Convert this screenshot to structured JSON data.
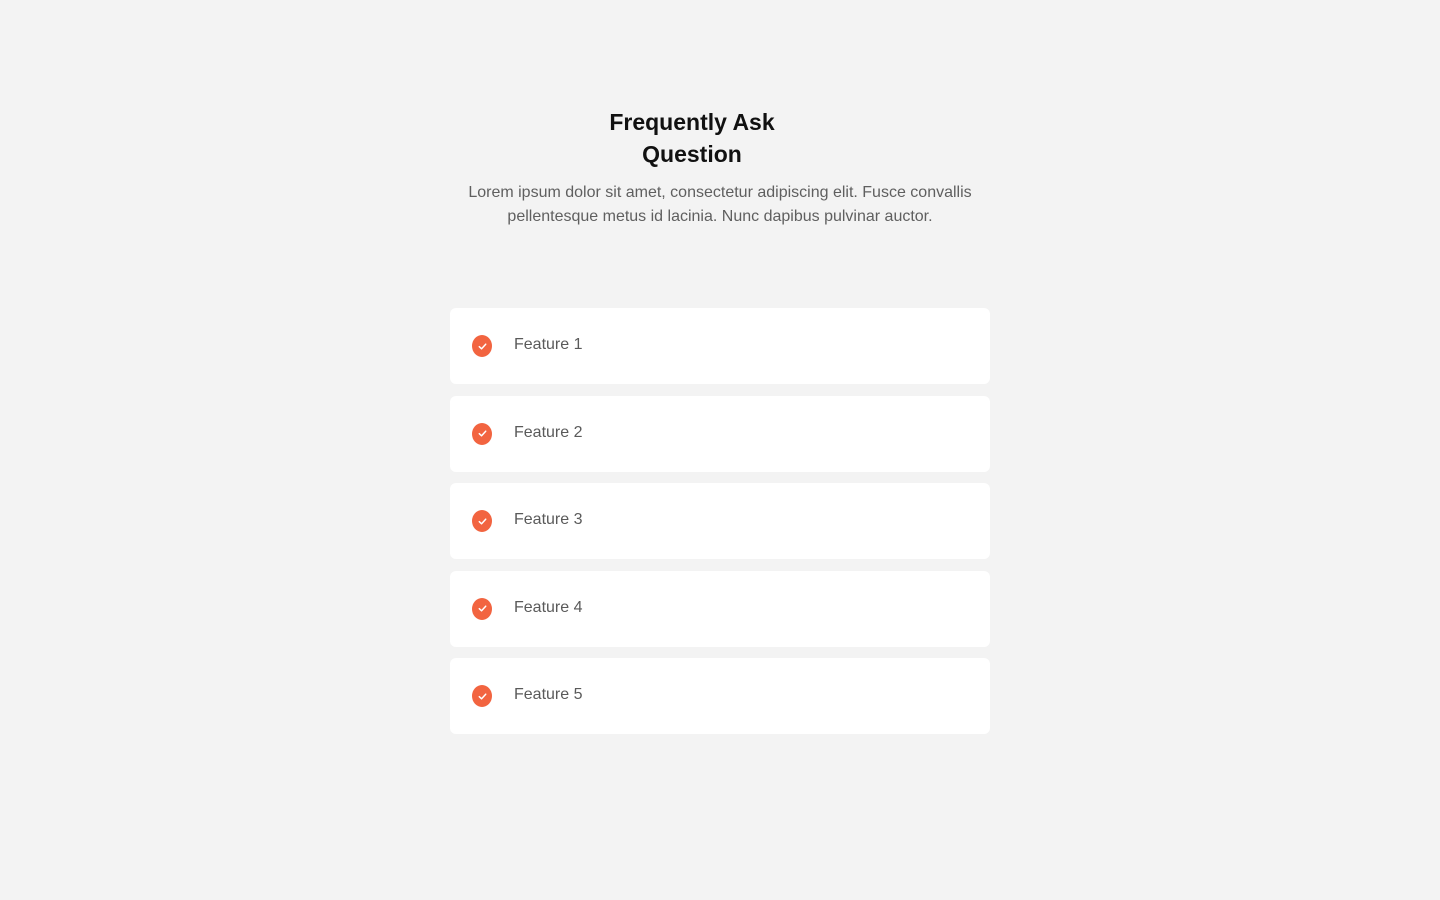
{
  "header": {
    "title_line1": "Frequently Ask",
    "title_line2": "Question",
    "description_line1": "Lorem ipsum dolor sit amet, consectetur adipiscing elit. Fusce convallis",
    "description_line2": "pellentesque metus id lacinia. Nunc dapibus pulvinar auctor."
  },
  "features": [
    {
      "label": "Feature 1",
      "icon": "check-circle-icon"
    },
    {
      "label": "Feature 2",
      "icon": "check-circle-icon"
    },
    {
      "label": "Feature 3",
      "icon": "check-circle-icon"
    },
    {
      "label": "Feature 4",
      "icon": "check-circle-icon"
    },
    {
      "label": "Feature 5",
      "icon": "check-circle-icon"
    }
  ],
  "colors": {
    "background": "#f3f3f3",
    "card": "#ffffff",
    "accent": "#f26440",
    "title": "#111111",
    "text": "#5f5f5f"
  }
}
